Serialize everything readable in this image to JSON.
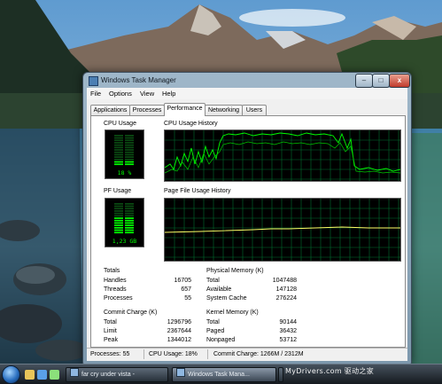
{
  "window": {
    "title": "Windows Task Manager",
    "caption": {
      "minimize": "–",
      "maximize": "□",
      "close": "x"
    }
  },
  "menu": [
    "File",
    "Options",
    "View",
    "Help"
  ],
  "tabs": [
    "Applications",
    "Processes",
    "Performance",
    "Networking",
    "Users"
  ],
  "active_tab": "Performance",
  "cpu": {
    "title": "CPU Usage",
    "value_text": "18 %",
    "level": 0.18,
    "history_title": "CPU Usage History"
  },
  "pf": {
    "title": "PF Usage",
    "value_text": "1,23 GB",
    "level": 0.53,
    "history_title": "Page File Usage History"
  },
  "totals": {
    "title": "Totals",
    "rows": [
      {
        "label": "Handles",
        "value": "16705"
      },
      {
        "label": "Threads",
        "value": "657"
      },
      {
        "label": "Processes",
        "value": "55"
      }
    ]
  },
  "physical_memory": {
    "title": "Physical Memory (K)",
    "rows": [
      {
        "label": "Total",
        "value": "1047488"
      },
      {
        "label": "Available",
        "value": "147128"
      },
      {
        "label": "System Cache",
        "value": "276224"
      }
    ]
  },
  "commit_charge": {
    "title": "Commit Charge (K)",
    "rows": [
      {
        "label": "Total",
        "value": "1296796"
      },
      {
        "label": "Limit",
        "value": "2367644"
      },
      {
        "label": "Peak",
        "value": "1344012"
      }
    ]
  },
  "kernel_memory": {
    "title": "Kernel Memory (K)",
    "rows": [
      {
        "label": "Total",
        "value": "90144"
      },
      {
        "label": "Paged",
        "value": "36432"
      },
      {
        "label": "Nonpaged",
        "value": "53712"
      }
    ]
  },
  "status": {
    "processes": "Processes: 55",
    "cpu": "CPU Usage: 18%",
    "commit": "Commit Charge: 1266M / 2312M"
  },
  "taskbar": {
    "buttons": [
      {
        "label": "far cry under vista -",
        "active": false
      },
      {
        "label": "Windows Task Mana...",
        "active": true
      },
      {
        "label": "",
        "active": false
      }
    ],
    "watermark": "MyDrivers.com 驱动之家"
  },
  "colors": {
    "graph_green": "#00ff00",
    "grid": "#006f2f",
    "pf_line": "#ffff66"
  }
}
